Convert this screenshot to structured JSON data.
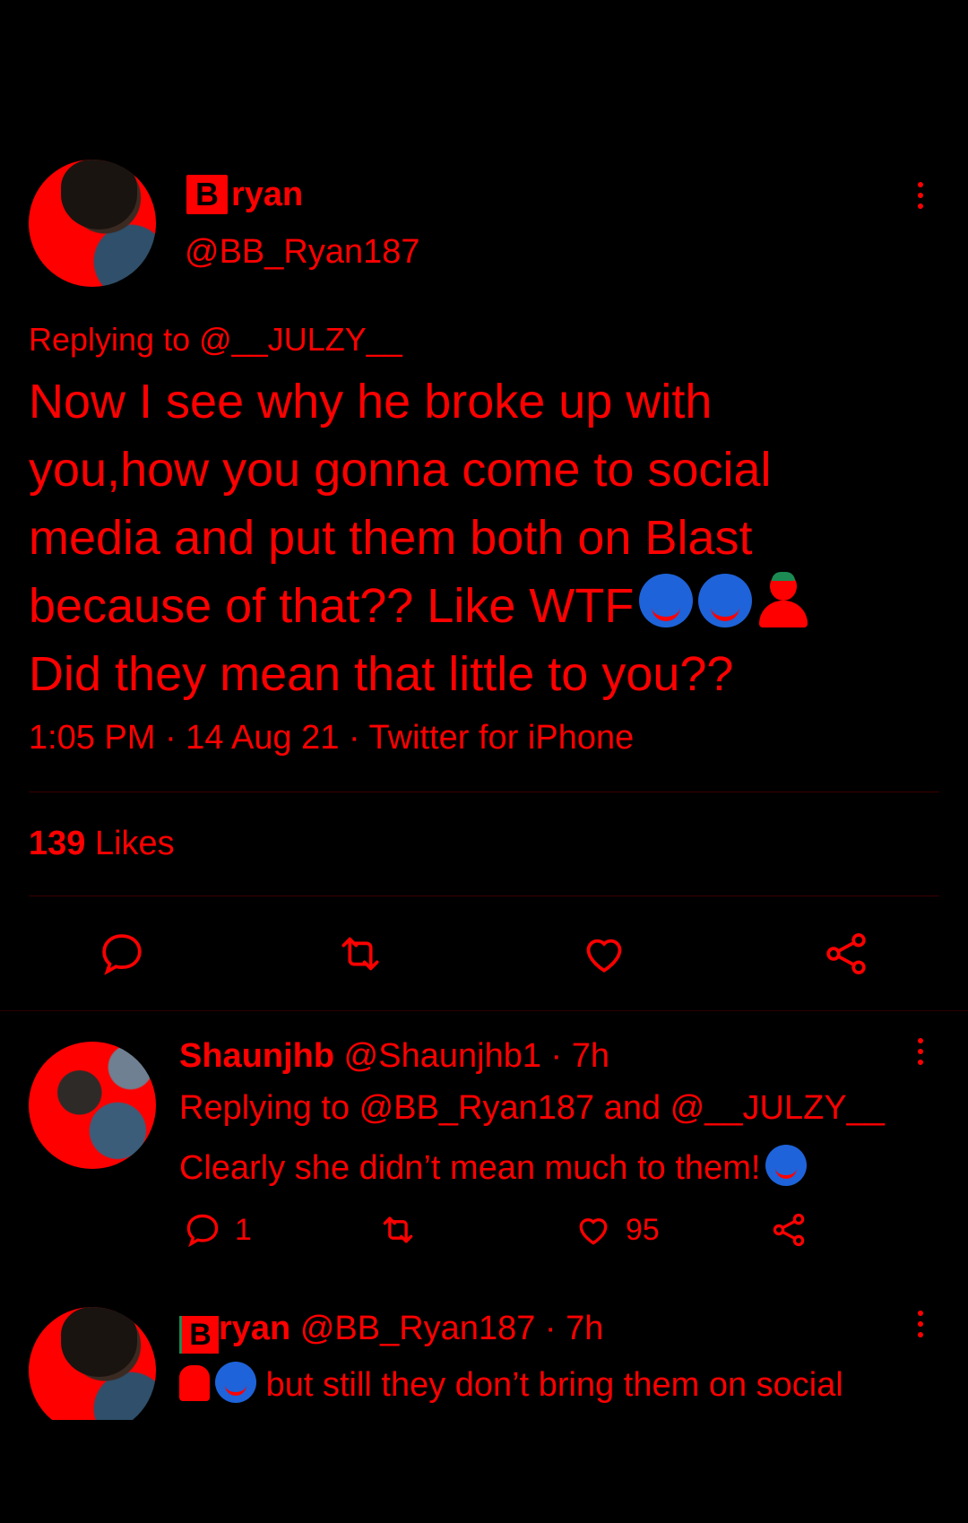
{
  "main_tweet": {
    "display_name": "ryan",
    "badge_letter": "B",
    "handle": "@BB_Ryan187",
    "replying_to": "Replying to @__JULZY__",
    "text_lines": [
      "Now I see why he broke up with",
      "you,how you gonna come to social",
      "media and put them both on Blast",
      "because of that?? Like WTF",
      "Did they mean that little to you??"
    ],
    "meta": "1:05 PM · 14 Aug 21 · Twitter for iPhone",
    "likes_count": "139",
    "likes_label": "Likes"
  },
  "replies": [
    {
      "name": "Shaunjhb",
      "handle_time": "@Shaunjhb1 · 7h",
      "replying_to": "Replying to @BB_Ryan187 and @__JULZY__",
      "text": "Clearly she didn’t mean much to them!",
      "reply_count": "1",
      "like_count": "95"
    },
    {
      "badge_letter": "B",
      "name": "ryan",
      "handle_time": "@BB_Ryan187 · 7h",
      "text": "but still they don’t bring them on social"
    }
  ],
  "colors": {
    "background": "#000000",
    "text": "#ff0000",
    "emoji_blue": "#1e63d9"
  }
}
